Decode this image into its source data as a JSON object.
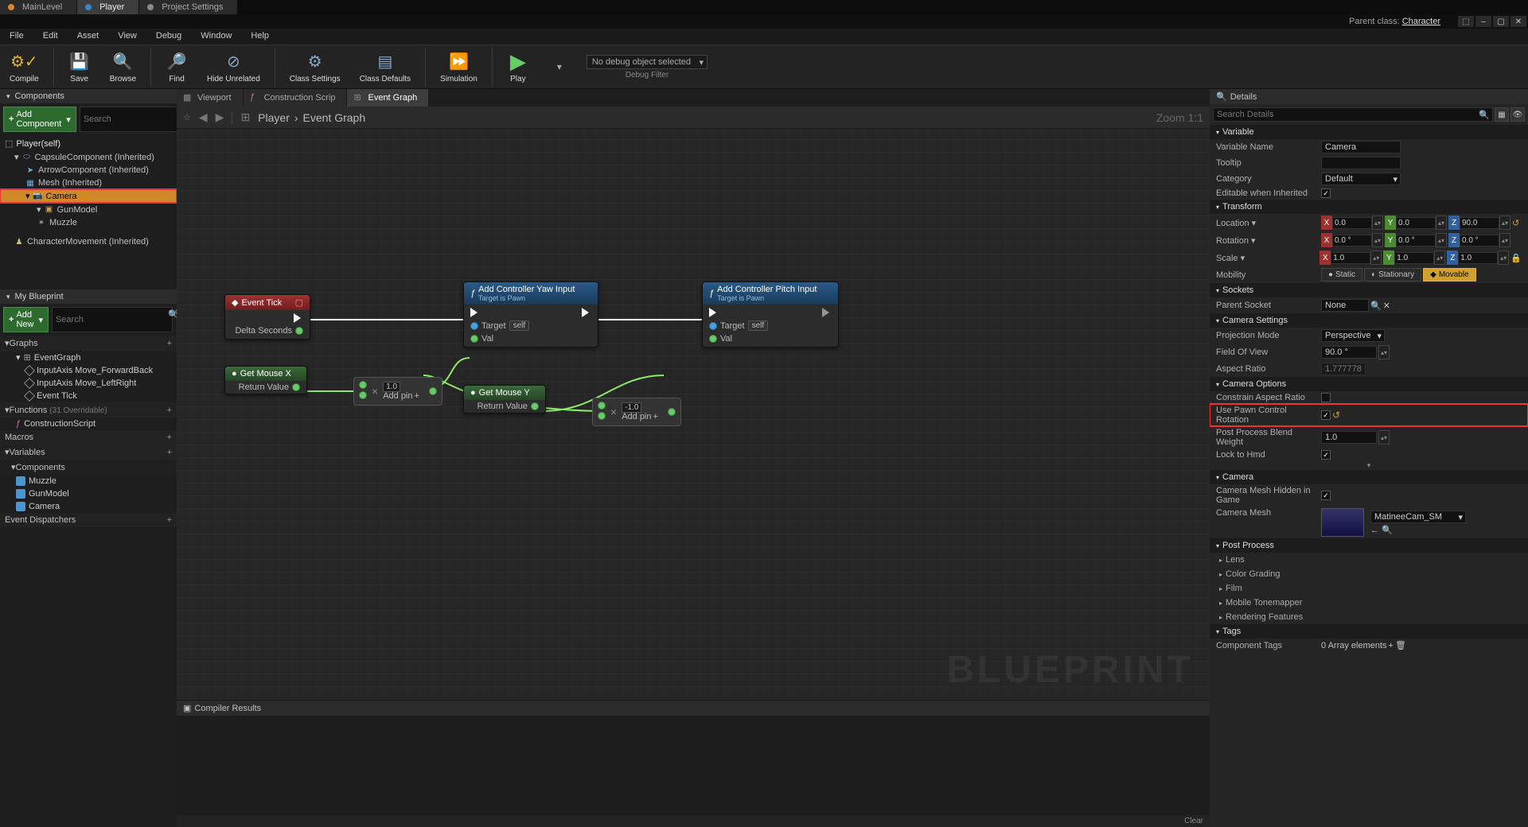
{
  "titlebar": {
    "parent_class_prefix": "Parent class: ",
    "parent_class": "Character"
  },
  "top_tabs": [
    "MainLevel",
    "Player",
    "Project Settings"
  ],
  "menu": [
    "File",
    "Edit",
    "Asset",
    "View",
    "Debug",
    "Window",
    "Help"
  ],
  "toolbar": {
    "compile": "Compile",
    "save": "Save",
    "browse": "Browse",
    "find": "Find",
    "hide_unrelated": "Hide Unrelated",
    "class_settings": "Class Settings",
    "class_defaults": "Class Defaults",
    "simulation": "Simulation",
    "play": "Play",
    "debug_sel": "No debug object selected",
    "debug_lbl": "Debug Filter"
  },
  "components": {
    "panel": "Components",
    "add_btn": "Add Component",
    "search_ph": "Search",
    "root": "Player(self)",
    "tree": [
      {
        "name": "CapsuleComponent (Inherited)",
        "indent": 1,
        "ico": "cap"
      },
      {
        "name": "ArrowComponent (Inherited)",
        "indent": 2,
        "ico": "arr"
      },
      {
        "name": "Mesh (Inherited)",
        "indent": 2,
        "ico": "mesh"
      },
      {
        "name": "Camera",
        "indent": 2,
        "ico": "cam",
        "sel": true
      },
      {
        "name": "GunModel",
        "indent": 3,
        "ico": "gun"
      },
      {
        "name": "Muzzle",
        "indent": 3,
        "ico": "muz"
      },
      {
        "name": "CharacterMovement (Inherited)",
        "indent": 1,
        "ico": "char"
      }
    ]
  },
  "my_blueprint": {
    "panel": "My Blueprint",
    "add_btn": "Add New",
    "search_ph": "Search",
    "sections": {
      "graphs": "Graphs",
      "graphs_items": [
        "EventGraph",
        "InputAxis Move_ForwardBack",
        "InputAxis Move_LeftRight",
        "Event Tick"
      ],
      "functions": "Functions",
      "functions_suffix": "(31 Overridable)",
      "func_items": [
        "ConstructionScript"
      ],
      "macros": "Macros",
      "variables": "Variables",
      "components_hdr": "Components",
      "comp_items": [
        "Muzzle",
        "GunModel",
        "Camera"
      ],
      "dispatchers": "Event Dispatchers"
    }
  },
  "graph": {
    "tabs": [
      "Viewport",
      "Construction Scrip",
      "Event Graph"
    ],
    "breadcrumb": [
      "Player",
      "Event Graph"
    ],
    "zoom": "Zoom 1:1",
    "watermark": "BLUEPRINT",
    "nodes": {
      "event_tick": {
        "title": "Event Tick",
        "pin": "Delta Seconds"
      },
      "yaw": {
        "title": "Add Controller Yaw Input",
        "sub": "Target is Pawn",
        "target": "Target",
        "self": "self",
        "val": "Val"
      },
      "pitch": {
        "title": "Add Controller Pitch Input",
        "sub": "Target is Pawn",
        "target": "Target",
        "self": "self",
        "val": "Val"
      },
      "mousex": {
        "title": "Get Mouse X",
        "pin": "Return Value"
      },
      "mousey": {
        "title": "Get Mouse Y",
        "pin": "Return Value"
      },
      "mult1_val": "1.0",
      "mult2_val": "-1.0",
      "add_pin": "Add pin"
    },
    "compiler": "Compiler Results",
    "clear": "Clear"
  },
  "details": {
    "panel": "Details",
    "search_ph": "Search Details",
    "variable": {
      "cat": "Variable",
      "name_lbl": "Variable Name",
      "name_val": "Camera",
      "tooltip_lbl": "Tooltip",
      "tooltip_val": "",
      "category_lbl": "Category",
      "category_val": "Default",
      "editable_lbl": "Editable when Inherited"
    },
    "transform": {
      "cat": "Transform",
      "loc_lbl": "Location",
      "loc": [
        "0.0",
        "0.0",
        "90.0"
      ],
      "rot_lbl": "Rotation",
      "rot": [
        "0.0 °",
        "0.0 °",
        "0.0 °"
      ],
      "scale_lbl": "Scale",
      "scale": [
        "1.0",
        "1.0",
        "1.0"
      ],
      "mobility_lbl": "Mobility",
      "mobility": [
        "Static",
        "Stationary",
        "Movable"
      ]
    },
    "sockets": {
      "cat": "Sockets",
      "parent_lbl": "Parent Socket",
      "parent_val": "None"
    },
    "camera_settings": {
      "cat": "Camera Settings",
      "proj_lbl": "Projection Mode",
      "proj_val": "Perspective",
      "fov_lbl": "Field Of View",
      "fov_val": "90.0 °",
      "aspect_lbl": "Aspect Ratio",
      "aspect_val": "1.777778"
    },
    "camera_options": {
      "cat": "Camera Options",
      "constrain_lbl": "Constrain Aspect Ratio",
      "pawn_lbl": "Use Pawn Control Rotation",
      "blend_lbl": "Post Process Blend Weight",
      "blend_val": "1.0",
      "lock_lbl": "Lock to Hmd"
    },
    "camera": {
      "cat": "Camera",
      "hidden_lbl": "Camera Mesh Hidden in Game",
      "mesh_lbl": "Camera Mesh",
      "mesh_val": "MatineeCam_SM"
    },
    "post_process": {
      "cat": "Post Process",
      "items": [
        "Lens",
        "Color Grading",
        "Film",
        "Mobile Tonemapper",
        "Rendering Features"
      ]
    },
    "tags": {
      "cat": "Tags",
      "comp_tags_lbl": "Component Tags",
      "comp_tags_val": "0 Array elements"
    }
  }
}
